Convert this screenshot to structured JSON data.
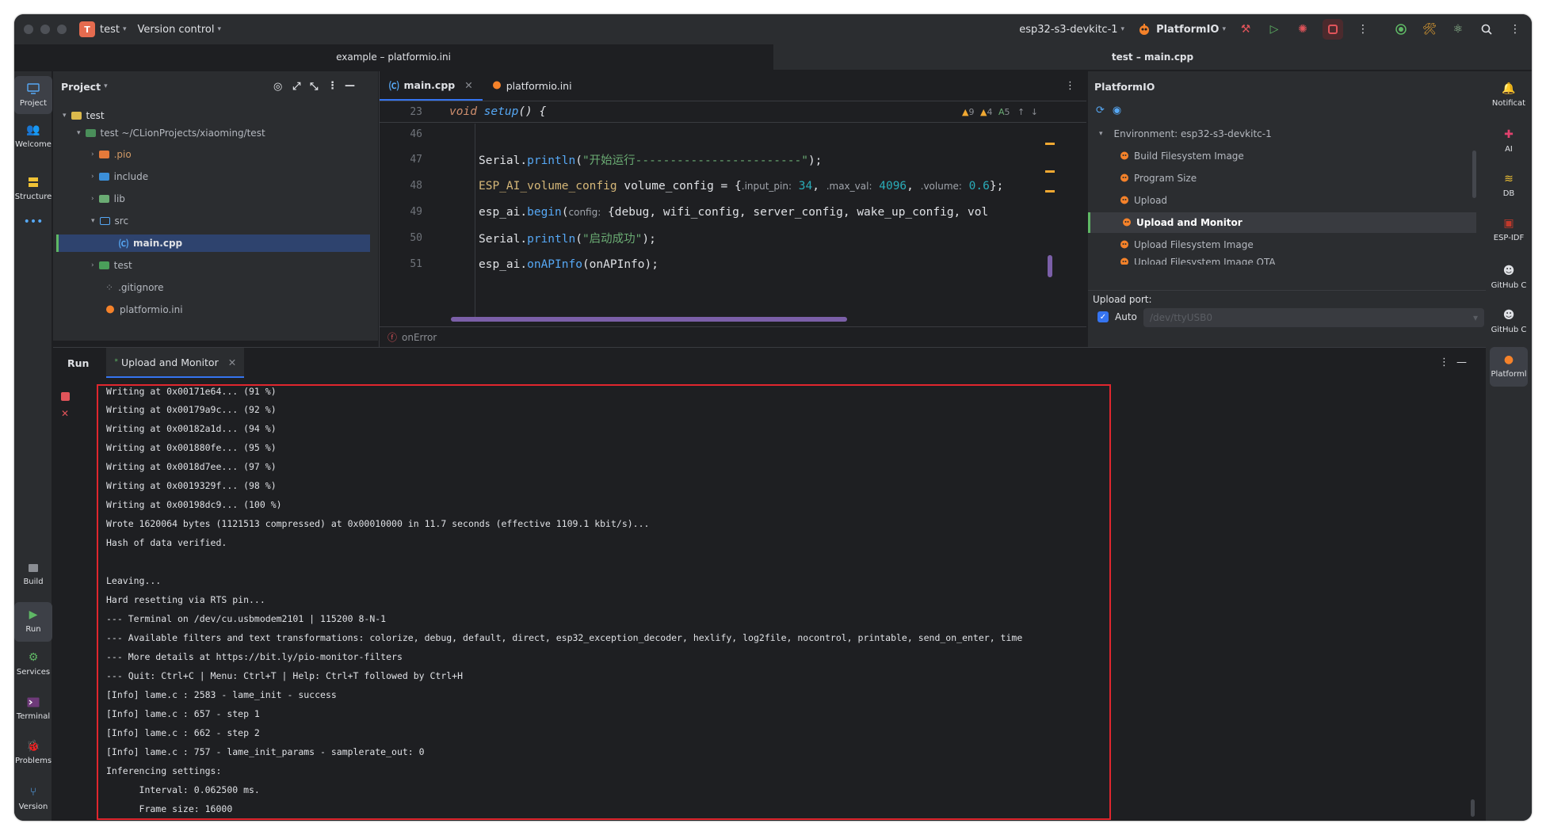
{
  "titlebar": {
    "project_badge": "T",
    "project_name": "test",
    "vcs": "Version control",
    "run_config": "esp32-s3-devkitc-1",
    "plugin": "PlatformIO"
  },
  "window_titles": {
    "left": "example – platformio.ini",
    "right": "test – main.cpp"
  },
  "left_stripe": [
    {
      "label": "Project",
      "icon": "monitor-icon"
    },
    {
      "label": "Welcome",
      "icon": "users-icon"
    },
    {
      "label": "Structure",
      "icon": "structure-icon"
    },
    {
      "label": "•••",
      "icon": "more-icon"
    },
    {
      "label": "Build",
      "icon": "build-icon"
    },
    {
      "label": "Run",
      "icon": "run-icon"
    },
    {
      "label": "Services",
      "icon": "services-icon"
    },
    {
      "label": "Terminal",
      "icon": "terminal-icon"
    },
    {
      "label": "Problems",
      "icon": "problems-icon"
    },
    {
      "label": "Version",
      "icon": "git-icon"
    }
  ],
  "right_stripe": [
    {
      "label": "Notificat",
      "icon": "bell-icon"
    },
    {
      "label": "AI",
      "icon": "ai-icon"
    },
    {
      "label": "DB",
      "icon": "database-icon"
    },
    {
      "label": "ESP-IDF",
      "icon": "chip-icon"
    },
    {
      "label": "GitHub C",
      "icon": "copilot-icon"
    },
    {
      "label": "GitHub C",
      "icon": "copilot-icon"
    },
    {
      "label": "Platforml",
      "icon": "platformio-icon"
    }
  ],
  "project_panel": {
    "title": "Project",
    "tree": [
      {
        "label": "test",
        "level": 0,
        "kind": "folder"
      },
      {
        "label": "test ~/CLionProjects/xiaoming/test",
        "level": 1,
        "kind": "module"
      },
      {
        "label": ".pio",
        "level": 2,
        "kind": "folder-orange"
      },
      {
        "label": "include",
        "level": 2,
        "kind": "folder-blue"
      },
      {
        "label": "lib",
        "level": 2,
        "kind": "folder-green"
      },
      {
        "label": "src",
        "level": 2,
        "kind": "folder-src"
      },
      {
        "label": "main.cpp",
        "level": 3,
        "kind": "cpp"
      },
      {
        "label": "test",
        "level": 2,
        "kind": "folder-test"
      },
      {
        "label": ".gitignore",
        "level": 2,
        "kind": "file"
      },
      {
        "label": "platformio.ini",
        "level": 2,
        "kind": "pio"
      }
    ]
  },
  "editor": {
    "tabs": [
      {
        "label": "main.cpp",
        "active": true
      },
      {
        "label": "platformio.ini",
        "active": false
      }
    ],
    "sticky_line": {
      "num": "23",
      "text": "void setup() {"
    },
    "inspections": {
      "warn1": "9",
      "warn2": "4",
      "typo": "5"
    },
    "lines": [
      {
        "num": "46",
        "text": ""
      },
      {
        "num": "47",
        "text": "Serial.println(\"开始运行------------------------\");"
      },
      {
        "num": "48",
        "text": "ESP_AI_volume_config volume_config = {.input_pin: 34, .max_val: 4096, .volume: 0.6};"
      },
      {
        "num": "49",
        "text": "esp_ai.begin(config: {debug, wifi_config, server_config, wake_up_config, vol"
      },
      {
        "num": "50",
        "text": "Serial.println(\"启动成功\");"
      },
      {
        "num": "51",
        "text": "esp_ai.onAPInfo(onAPInfo);"
      }
    ],
    "breadcrumb": "onError"
  },
  "pio_panel": {
    "title": "PlatformIO",
    "environment": "Environment: esp32-s3-devkitc-1",
    "tasks": [
      "Build Filesystem Image",
      "Program Size",
      "Upload",
      "Upload and Monitor",
      "Upload Filesystem Image",
      "Upload Filesystem Image OTA"
    ],
    "selected_task": "Upload and Monitor",
    "upload_port_label": "Upload port:",
    "auto_label": "Auto",
    "port_placeholder": "/dev/ttyUSB0"
  },
  "run_panel": {
    "title": "Run",
    "tab_label": "Upload and Monitor",
    "console_lines": [
      "Writing at 0x00171e64... (91 %)",
      "Writing at 0x00179a9c... (92 %)",
      "Writing at 0x00182a1d... (94 %)",
      "Writing at 0x001880fe... (95 %)",
      "Writing at 0x0018d7ee... (97 %)",
      "Writing at 0x0019329f... (98 %)",
      "Writing at 0x00198dc9... (100 %)",
      "Wrote 1620064 bytes (1121513 compressed) at 0x00010000 in 11.7 seconds (effective 1109.1 kbit/s)...",
      "Hash of data verified.",
      "",
      "Leaving...",
      "Hard resetting via RTS pin...",
      "--- Terminal on /dev/cu.usbmodem2101 | 115200 8-N-1",
      "--- Available filters and text transformations: colorize, debug, default, direct, esp32_exception_decoder, hexlify, log2file, nocontrol, printable, send_on_enter, time",
      "--- More details at https://bit.ly/pio-monitor-filters",
      "--- Quit: Ctrl+C | Menu: Ctrl+T | Help: Ctrl+T followed by Ctrl+H",
      "[Info] lame.c : 2583 - lame_init - success",
      "[Info] lame.c : 657 - step 1",
      "[Info] lame.c : 662 - step 2",
      "[Info] lame.c : 757 - lame_init_params - samplerate_out: 0",
      "Inferencing settings:",
      "      Interval: 0.062500 ms.",
      "      Frame size: 16000"
    ]
  },
  "colors": {
    "accent": "#3574f0",
    "highlight_border": "#e0262e",
    "keyword": "#cf8e6d",
    "function": "#56a8f5",
    "string": "#6aab73",
    "number": "#2aacb8",
    "pio_orange": "#f5822a"
  }
}
